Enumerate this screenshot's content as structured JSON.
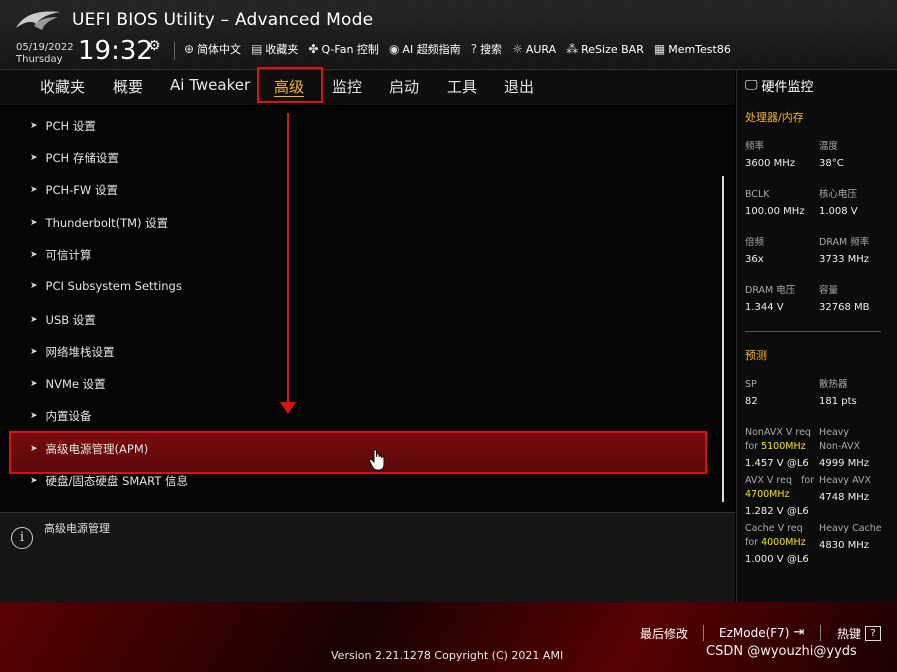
{
  "header": {
    "title": "UEFI BIOS Utility – Advanced Mode",
    "date": "05/19/2022",
    "day": "Thursday",
    "time": "19:32",
    "tools": [
      {
        "icon": "globe-icon",
        "label": "简体中文"
      },
      {
        "icon": "favorites-icon",
        "label": "收藏夹"
      },
      {
        "icon": "fan-icon",
        "label": "Q-Fan 控制"
      },
      {
        "icon": "ai-overclock-icon",
        "label": "AI 超频指南"
      },
      {
        "icon": "help-search-icon",
        "label": "搜索"
      },
      {
        "icon": "aura-icon",
        "label": "AURA"
      },
      {
        "icon": "resize-bar-icon",
        "label": "ReSize BAR"
      },
      {
        "icon": "memtest-icon",
        "label": "MemTest86"
      }
    ]
  },
  "tabs": [
    "收藏夹",
    "概要",
    "Ai Tweaker",
    "高级",
    "监控",
    "启动",
    "工具",
    "退出"
  ],
  "active_tab": "高级",
  "menu_items": [
    "PCH 设置",
    "PCH 存储设置",
    "PCH-FW 设置",
    "Thunderbolt(TM) 设置",
    "可信计算",
    "PCI Subsystem Settings",
    "USB 设置",
    "网络堆栈设置",
    "NVMe 设置",
    "内置设备",
    "高级电源管理(APM)",
    "硬盘/固态硬盘 SMART 信息"
  ],
  "selected_item": "高级电源管理(APM)",
  "help_text": "高级电源管理",
  "hw_monitor": {
    "title": "硬件监控",
    "cpu_section": "处理器/内存",
    "cpu": [
      {
        "label": "频率",
        "value": "3600 MHz"
      },
      {
        "label": "温度",
        "value": "38°C"
      },
      {
        "label": "BCLK",
        "value": "100.00 MHz"
      },
      {
        "label": "核心电压",
        "value": "1.008 V"
      },
      {
        "label": "倍频",
        "value": "36x"
      },
      {
        "label": "DRAM 频率",
        "value": "3733 MHz"
      },
      {
        "label": "DRAM 电压",
        "value": "1.344 V"
      },
      {
        "label": "容量",
        "value": "32768 MB"
      }
    ],
    "pred_section": "预测",
    "pred": {
      "sp_label": "SP",
      "sp_value": "82",
      "cooler_label": "散热器",
      "cooler_value": "181 pts",
      "nonavx_label": "NonAVX V req",
      "nonavx_for": "for",
      "nonavx_freq": "5100MHz",
      "nonavx_value": "1.457 V @L6",
      "heavy_nonavx_label1": "Heavy",
      "heavy_nonavx_label2": "Non-AVX",
      "heavy_nonavx_value": "4999 MHz",
      "avx_label": "AVX V req",
      "avx_for": "for",
      "avx_freq": "4700MHz",
      "avx_value": "1.282 V @L6",
      "heavy_avx_label": "Heavy AVX",
      "heavy_avx_value": "4748 MHz",
      "cache_label": "Cache V req",
      "cache_for": "for",
      "cache_freq": "4000MHz",
      "cache_value": "1.000 V @L6",
      "heavy_cache_label": "Heavy Cache",
      "heavy_cache_value": "4830 MHz"
    }
  },
  "bottom": {
    "last_modified": "最后修改",
    "ezmode": "EzMode(F7)",
    "hotkeys": "热键",
    "hotkeys_key": "?",
    "version": "Version 2.21.1278 Copyright (C) 2021 AMI",
    "watermark": "CSDN @wyouzhi@yyds"
  },
  "colors": {
    "accent": "#f4b51f",
    "highlight": "#e01010",
    "value_highlight": "#f4e600"
  }
}
